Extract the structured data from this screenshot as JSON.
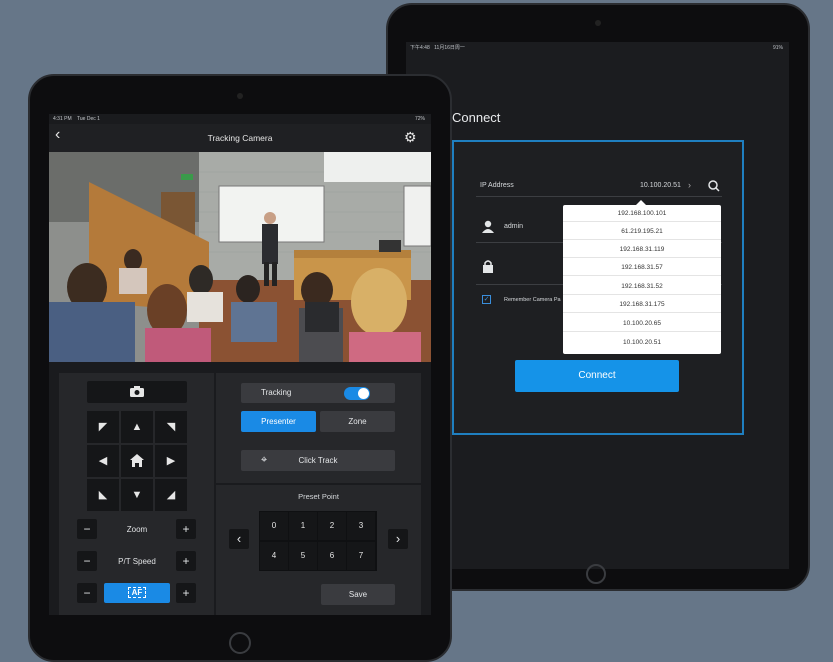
{
  "back_device": {
    "status_time": "下午4:48",
    "status_date": "11月16日周一",
    "status_battery": "91%",
    "title": "Connect",
    "ip_label": "IP Address",
    "ip_value": "10.100.20.51",
    "username": "admin",
    "remember_label": "Remember Camera Pa",
    "connect_button": "Connect",
    "dropdown": [
      "192.168.100.101",
      "61.219.195.21",
      "192.168.31.119",
      "192.168.31.57",
      "192.168.31.52",
      "192.168.31.175",
      "10.100.20.65",
      "10.100.20.51"
    ]
  },
  "front_device": {
    "status_time": "4:31 PM",
    "status_date": "Tue Dec 1",
    "status_battery": "72%",
    "title": "Tracking Camera",
    "zoom_label": "Zoom",
    "pt_speed_label": "P/T Speed",
    "af_label": "AF",
    "tracking_label": "Tracking",
    "tracking_on": true,
    "presenter_label": "Presenter",
    "zone_label": "Zone",
    "click_track_label": "Click Track",
    "preset_label": "Preset Point",
    "presets": [
      "0",
      "1",
      "2",
      "3",
      "4",
      "5",
      "6",
      "7"
    ],
    "save_label": "Save",
    "minus": "−",
    "plus": "+"
  },
  "colors": {
    "accent": "#1a8ae5",
    "background": "#667688",
    "panel": "#26272a"
  }
}
